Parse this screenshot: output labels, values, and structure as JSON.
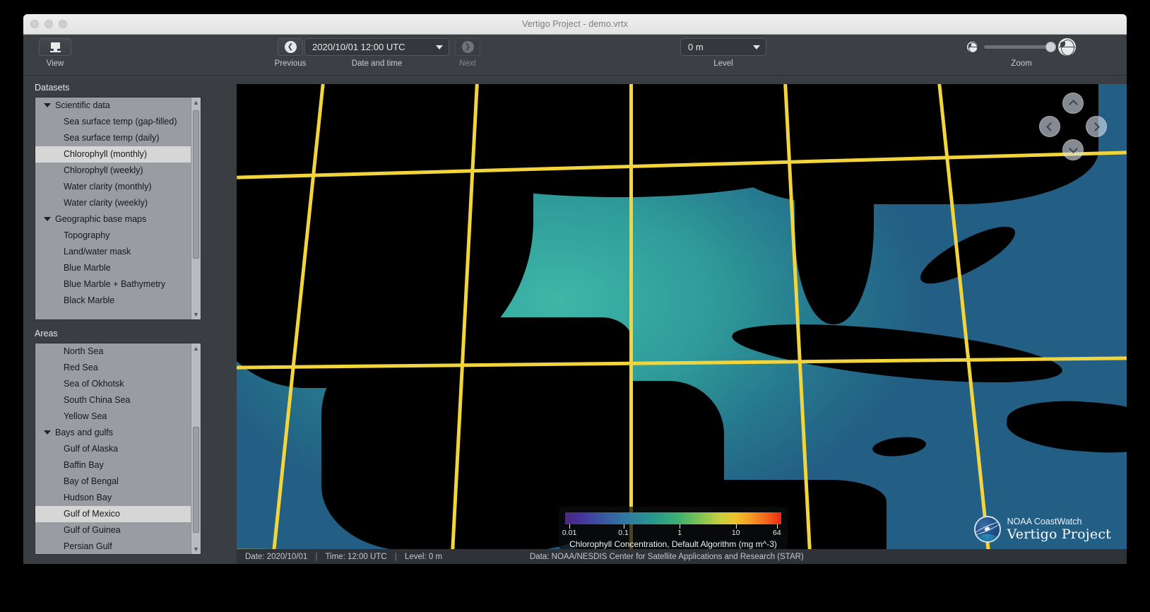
{
  "window": {
    "title": "Vertigo Project - demo.vrtx"
  },
  "toolbar": {
    "view": {
      "label": "View",
      "icon": "monitor-icon"
    },
    "previous": {
      "label": "Previous",
      "icon": "previous-arrow-icon"
    },
    "next": {
      "label": "Next",
      "icon": "next-arrow-icon",
      "disabled": true
    },
    "datetime": {
      "label": "Date and time",
      "value": "2020/10/01 12:00 UTC"
    },
    "level": {
      "label": "Level",
      "value": "0 m"
    },
    "zoom": {
      "label": "Zoom",
      "small_icon": "globe-small-icon",
      "large_icon": "globe-large-icon",
      "slider_value": 100
    }
  },
  "sidebar": {
    "datasets": {
      "label": "Datasets",
      "items": [
        {
          "label": "Scientific data",
          "type": "group",
          "expanded": true
        },
        {
          "label": "Sea surface temp (gap-filled)",
          "type": "child"
        },
        {
          "label": "Sea surface temp (daily)",
          "type": "child"
        },
        {
          "label": "Chlorophyll (monthly)",
          "type": "child",
          "selected": true
        },
        {
          "label": "Chlorophyll (weekly)",
          "type": "child"
        },
        {
          "label": "Water clarity (monthly)",
          "type": "child"
        },
        {
          "label": "Water clarity (weekly)",
          "type": "child"
        },
        {
          "label": "Geographic base maps",
          "type": "group",
          "expanded": true
        },
        {
          "label": "Topography",
          "type": "child"
        },
        {
          "label": "Land/water mask",
          "type": "child"
        },
        {
          "label": "Blue Marble",
          "type": "child"
        },
        {
          "label": "Blue Marble + Bathymetry",
          "type": "child"
        },
        {
          "label": "Black Marble",
          "type": "child"
        }
      ]
    },
    "areas": {
      "label": "Areas",
      "items": [
        {
          "label": "North Sea",
          "type": "child"
        },
        {
          "label": "Red Sea",
          "type": "child"
        },
        {
          "label": "Sea of Okhotsk",
          "type": "child"
        },
        {
          "label": "South China Sea",
          "type": "child"
        },
        {
          "label": "Yellow Sea",
          "type": "child"
        },
        {
          "label": "Bays and gulfs",
          "type": "group",
          "expanded": true
        },
        {
          "label": "Gulf of Alaska",
          "type": "child"
        },
        {
          "label": "Baffin Bay",
          "type": "child"
        },
        {
          "label": "Bay of Bengal",
          "type": "child"
        },
        {
          "label": "Hudson Bay",
          "type": "child"
        },
        {
          "label": "Gulf of Mexico",
          "type": "child",
          "selected": true
        },
        {
          "label": "Gulf of Guinea",
          "type": "child"
        },
        {
          "label": "Persian Gulf",
          "type": "child"
        }
      ]
    }
  },
  "map": {
    "navigation": {
      "up": "pan-up-icon",
      "down": "pan-down-icon",
      "left": "pan-left-icon",
      "right": "pan-right-icon"
    },
    "grid_color": "#f2d43c"
  },
  "legend": {
    "caption": "Chlorophyll Concentration, Default Algorithm (mg m^-3)",
    "ticks": [
      {
        "label": "0.01",
        "pos": 2
      },
      {
        "label": "0.1",
        "pos": 27
      },
      {
        "label": "1",
        "pos": 53
      },
      {
        "label": "10",
        "pos": 79
      },
      {
        "label": "64",
        "pos": 98
      }
    ],
    "colors": [
      "#4a2a7a",
      "#3c53a0",
      "#27968f",
      "#84c452",
      "#efc12c",
      "#ec2a13"
    ]
  },
  "branding": {
    "line1": "NOAA CoastWatch",
    "line2": "Vertigo Project"
  },
  "statusbar": {
    "date": "Date: 2020/10/01",
    "time": "Time: 12:00 UTC",
    "level": "Level: 0 m",
    "source": "Data: NOAA/NESDIS Center for Satellite Applications and Research (STAR)"
  }
}
